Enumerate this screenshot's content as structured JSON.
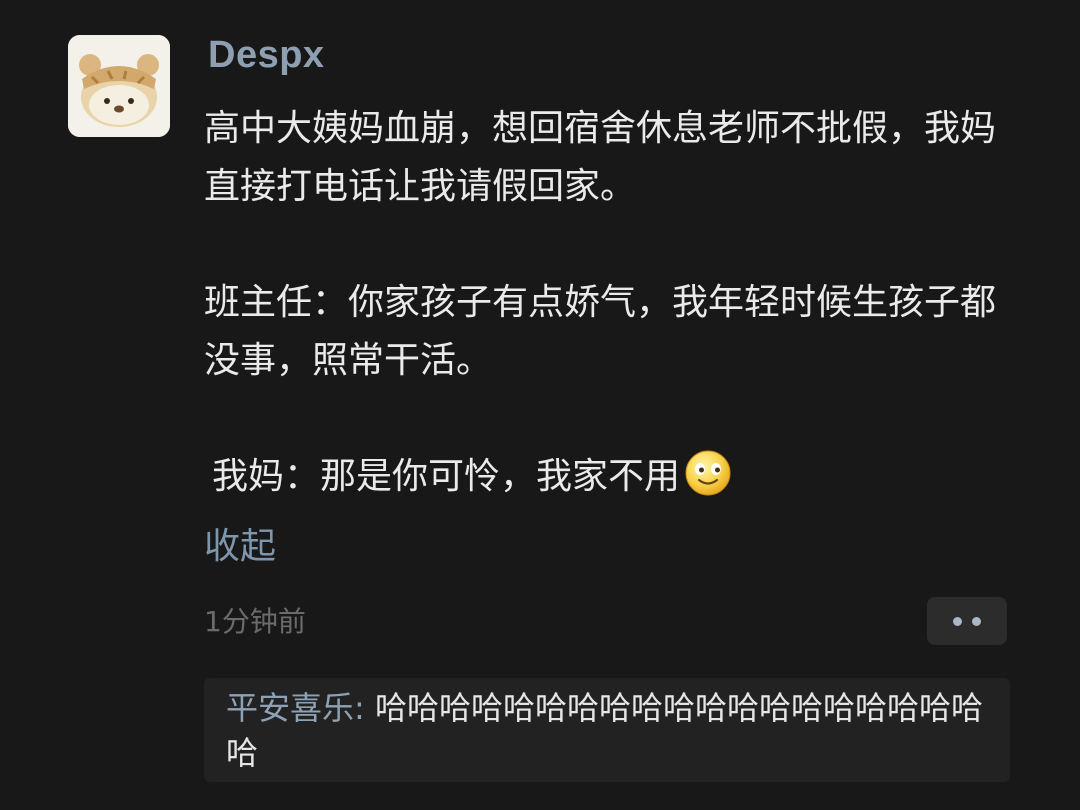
{
  "post": {
    "author": "Despx",
    "avatar_icon": "bear-avatar-icon",
    "paragraphs": [
      "高中大姨妈血崩，想回宿舍休息老师不批假，我妈直接打电话让我请假回家。",
      "班主任：你家孩子有点娇气，我年轻时候生孩子都没事，照常干活。"
    ],
    "last_paragraph": "我妈：那是你可怜，我家不用",
    "emoji": "smile-emoji-icon",
    "collapse_label": "收起",
    "time": "1分钟前"
  },
  "more_button_icon": "more-dots-icon",
  "reply": {
    "user": "平安喜乐",
    "separator": ": ",
    "text": "哈哈哈哈哈哈哈哈哈哈哈哈哈哈哈哈哈哈哈哈"
  },
  "colors": {
    "background": "#181818",
    "username": "#8e9fb1",
    "link": "#7e96ad",
    "body_text": "#eaeaea",
    "muted": "#6b6b6b"
  }
}
